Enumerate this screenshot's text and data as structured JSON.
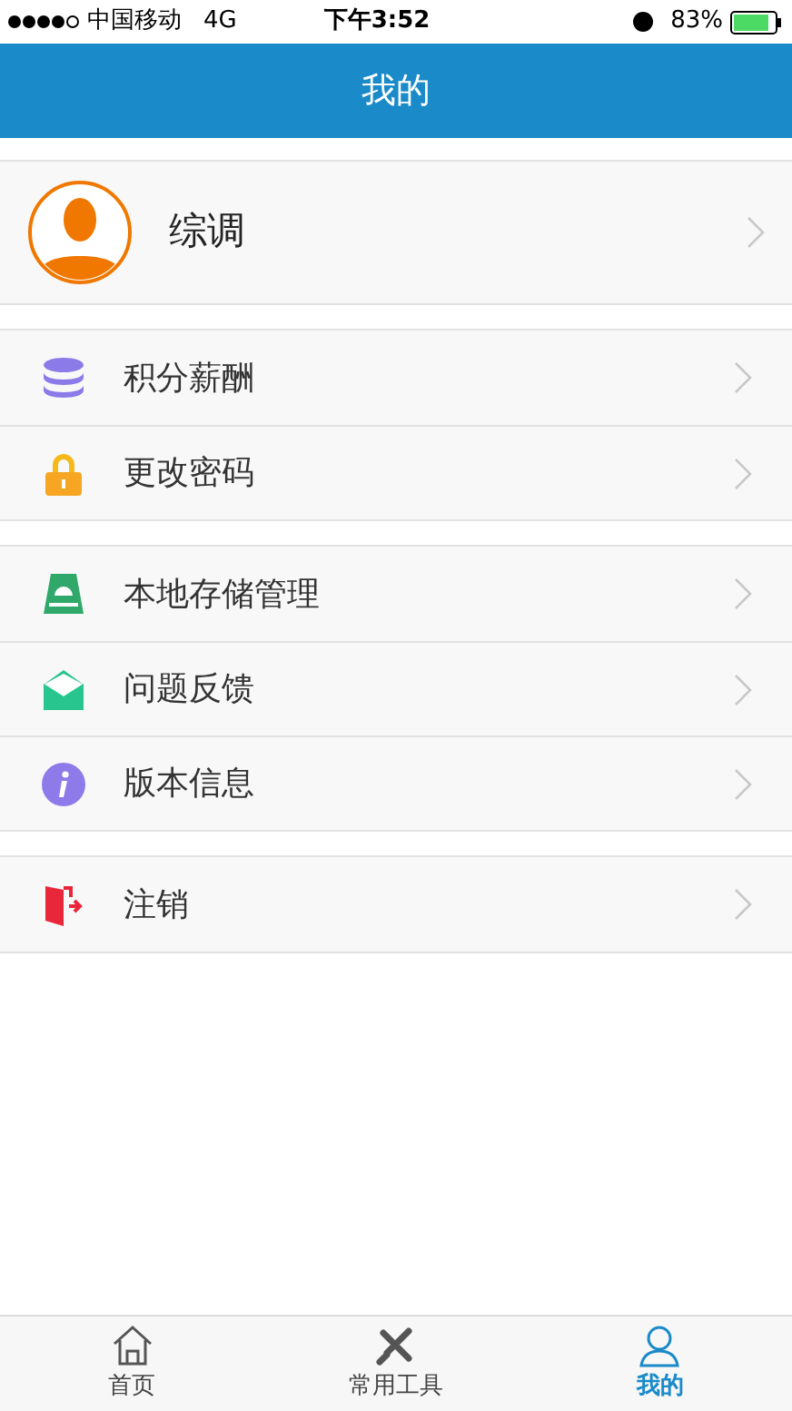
{
  "status_bar": {
    "carrier": "中国移动",
    "network": "4G",
    "time": "下午3:52",
    "battery": "83%"
  },
  "header": {
    "title": "我的"
  },
  "profile": {
    "name": "综调"
  },
  "menu_groups": [
    [
      {
        "kind": "coins",
        "label": "积分薪酬"
      },
      {
        "kind": "lock",
        "label": "更改密码"
      }
    ],
    [
      {
        "kind": "storage",
        "label": "本地存储管理"
      },
      {
        "kind": "mail",
        "label": "问题反馈"
      },
      {
        "kind": "info",
        "label": "版本信息"
      }
    ],
    [
      {
        "kind": "logout",
        "label": "注销"
      }
    ]
  ],
  "tab_bar": [
    {
      "kind": "home",
      "label": "首页",
      "selected": false
    },
    {
      "kind": "tools",
      "label": "常用工具",
      "selected": false
    },
    {
      "kind": "user",
      "label": "我的",
      "selected": true
    }
  ]
}
